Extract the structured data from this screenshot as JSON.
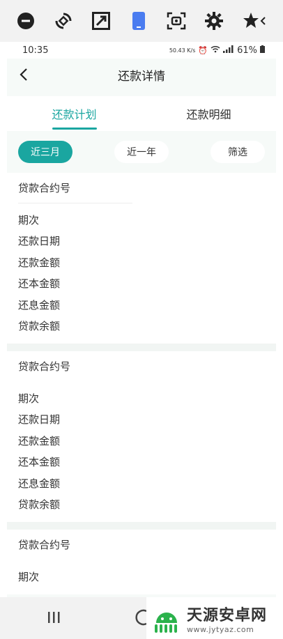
{
  "status_bar": {
    "time": "10:35",
    "net_speed": "50.43 K/s",
    "battery": "61%"
  },
  "header": {
    "title": "还款详情"
  },
  "tabs": [
    {
      "label": "还款计划",
      "active": true
    },
    {
      "label": "还款明细",
      "active": false
    }
  ],
  "filters": [
    {
      "label": "近三月",
      "active": true
    },
    {
      "label": "近一年",
      "active": false
    },
    {
      "label": "筛选",
      "active": false
    }
  ],
  "cards": [
    {
      "contract_label": "贷款合约号",
      "fields": [
        "期次",
        "还款日期",
        "还款金额",
        "还本金额",
        "还息金额",
        "贷款余额"
      ]
    },
    {
      "contract_label": "贷款合约号",
      "fields": [
        "期次",
        "还款日期",
        "还款金额",
        "还本金额",
        "还息金额",
        "贷款余额"
      ]
    },
    {
      "contract_label": "贷款合约号",
      "fields": [
        "期次"
      ]
    }
  ],
  "watermark": {
    "name": "天源安卓网",
    "url": "www.jytyaz.com"
  },
  "colors": {
    "accent": "#1aa6a0",
    "background": "#f6faf8"
  }
}
